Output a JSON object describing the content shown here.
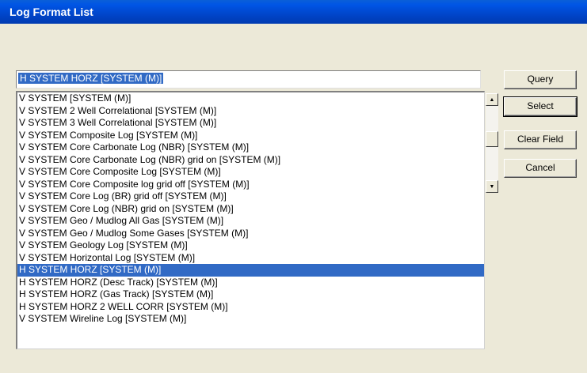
{
  "window": {
    "title": "Log Format List"
  },
  "input": {
    "value": "H  SYSTEM HORZ [SYSTEM (M)]"
  },
  "list": {
    "items": [
      "V  SYSTEM [SYSTEM (M)]",
      "V  SYSTEM 2 Well Correlational [SYSTEM (M)]",
      "V  SYSTEM 3 Well Correlational [SYSTEM (M)]",
      "V  SYSTEM Composite Log [SYSTEM (M)]",
      "V  SYSTEM Core Carbonate Log (NBR) [SYSTEM (M)]",
      "V  SYSTEM Core Carbonate Log (NBR) grid on [SYSTEM (M)]",
      "V  SYSTEM Core Composite Log [SYSTEM (M)]",
      "V  SYSTEM Core Composite log grid off [SYSTEM (M)]",
      "V  SYSTEM Core Log (BR) grid off [SYSTEM (M)]",
      "V  SYSTEM Core Log (NBR) grid on [SYSTEM (M)]",
      "V  SYSTEM Geo / Mudlog All Gas [SYSTEM (M)]",
      "V  SYSTEM Geo / Mudlog Some Gases [SYSTEM (M)]",
      "V  SYSTEM Geology Log [SYSTEM (M)]",
      "V  SYSTEM Horizontal Log [SYSTEM (M)]",
      "H  SYSTEM HORZ [SYSTEM (M)]",
      "H  SYSTEM HORZ (Desc Track) [SYSTEM (M)]",
      "H  SYSTEM HORZ (Gas Track) [SYSTEM (M)]",
      "H  SYSTEM HORZ 2 WELL CORR [SYSTEM (M)]",
      "V  SYSTEM Wireline Log [SYSTEM (M)]"
    ],
    "selected_index": 14
  },
  "scrollbar": {
    "up_icon": "▲",
    "down_icon": "▼"
  },
  "buttons": {
    "query": "Query",
    "select": "Select",
    "clear_field": "Clear Field",
    "cancel": "Cancel"
  },
  "colors": {
    "selection": "#316ac5",
    "titlebar": "#0055e5",
    "dialog": "#ece9d8"
  }
}
